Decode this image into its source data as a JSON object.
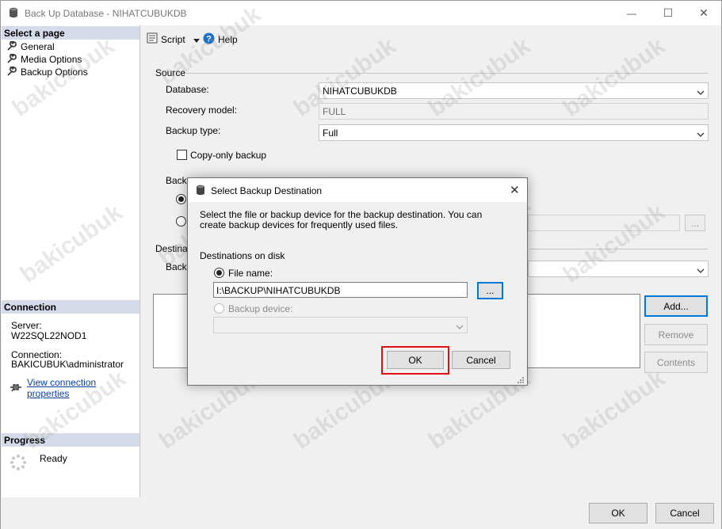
{
  "window": {
    "title": "Back Up Database - NIHATCUBUKDB",
    "controls": {
      "minimize": "—",
      "maximize": "☐",
      "close": "✕"
    }
  },
  "sidebar": {
    "select_page_header": "Select a page",
    "pages": [
      {
        "label": "General",
        "icon": "wrench-icon"
      },
      {
        "label": "Media Options",
        "icon": "wrench-icon"
      },
      {
        "label": "Backup Options",
        "icon": "wrench-icon"
      }
    ],
    "connection_header": "Connection",
    "server_label": "Server:",
    "server_value": "W22SQL22NOD1",
    "connection_label": "Connection:",
    "connection_value": "BAKICUBUK\\administrator",
    "view_props_link": "View connection properties",
    "progress_header": "Progress",
    "progress_status": "Ready"
  },
  "toolbar": {
    "script_label": "Script",
    "help_label": "Help"
  },
  "general": {
    "source_label": "Source",
    "database_label": "Database:",
    "database_value": "NIHATCUBUKDB",
    "recovery_label": "Recovery model:",
    "recovery_value": "FULL",
    "backup_type_label": "Backup type:",
    "backup_type_value": "Full",
    "copy_only_label": "Copy-only backup",
    "backup_component_partial": "Backu",
    "destination_partial": "Destinati",
    "back_up_to_partial": "Back",
    "browse_ellipsis": "...",
    "add_button": "Add...",
    "remove_button": "Remove",
    "contents_button": "Contents"
  },
  "footer": {
    "ok_label": "OK",
    "cancel_label": "Cancel"
  },
  "dialog": {
    "title": "Select Backup Destination",
    "description": "Select the file or backup device for the backup destination. You can create backup devices for frequently used files.",
    "destinations_label": "Destinations on disk",
    "file_name_label": "File name:",
    "file_name_value": "I:\\BACKUP\\NIHATCUBUKDB",
    "browse_label": "...",
    "backup_device_label": "Backup device:",
    "ok_label": "OK",
    "cancel_label": "Cancel"
  },
  "watermark": "bakicubuk",
  "colors": {
    "header_band": "#d6dbe9",
    "highlight_red": "#e01010",
    "focus_blue": "#0078d7",
    "link_blue": "#0a3fa0"
  }
}
